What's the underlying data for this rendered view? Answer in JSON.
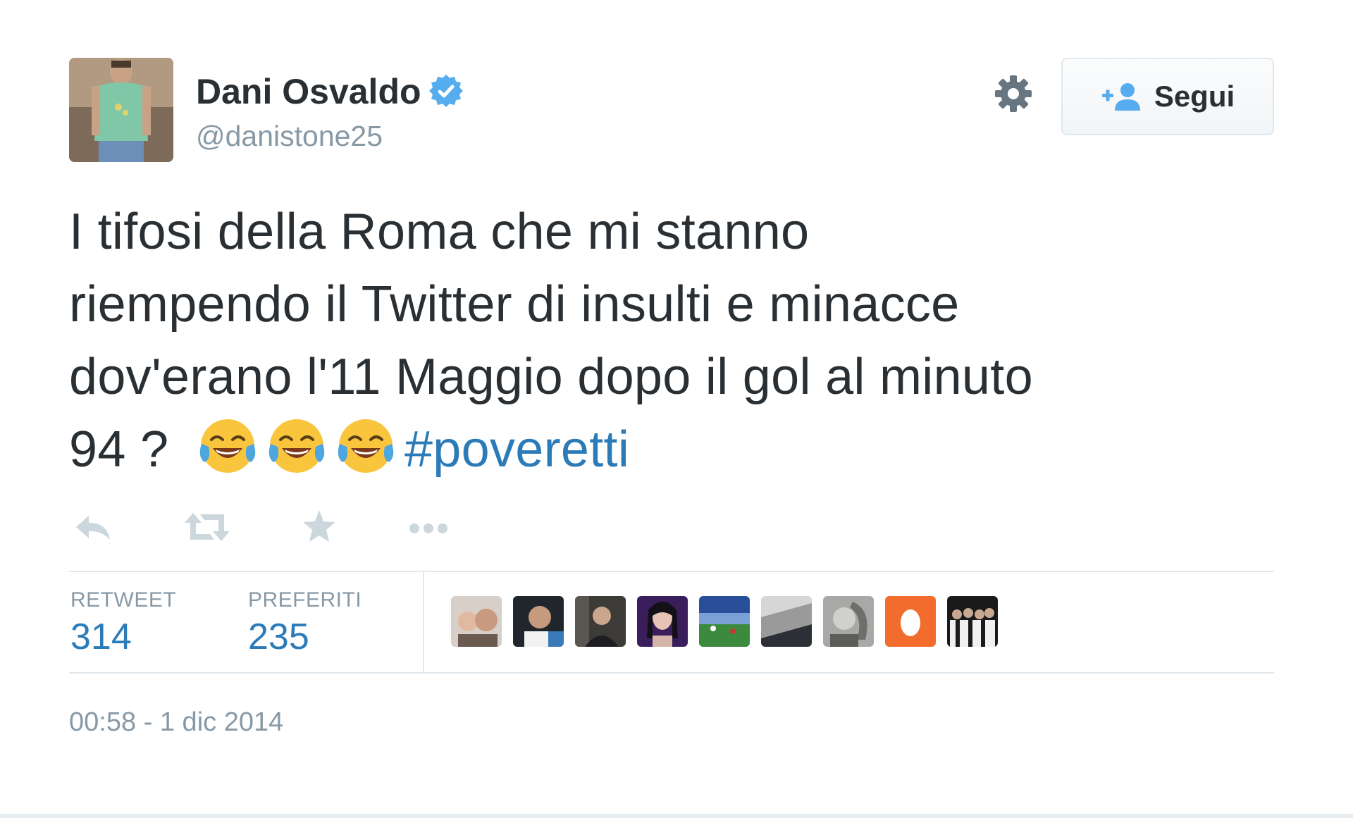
{
  "author": {
    "display_name": "Dani Osvaldo",
    "handle": "@danistone25",
    "verified": true,
    "avatar_icon": "profile-photo"
  },
  "header": {
    "settings_icon": "gear-icon",
    "follow_label": "Segui",
    "follow_icon": "add-user-icon"
  },
  "tweet": {
    "lines": [
      "I tifosi della Roma che mi stanno",
      "riempendo il Twitter di insulti e minacce",
      "dov'erano l'11 Maggio dopo il gol al minuto",
      "94 ?"
    ],
    "emoji_icon": "face-with-tears-of-joy-icon",
    "emoji_count": 3,
    "hashtag": "#poveretti"
  },
  "actions": [
    {
      "name": "reply-icon"
    },
    {
      "name": "retweet-icon"
    },
    {
      "name": "favorite-star-icon"
    },
    {
      "name": "more-dots-icon"
    }
  ],
  "stats": {
    "retweet_label": "RETWEET",
    "retweet_count": "314",
    "favorites_label": "PREFERITI",
    "favorites_count": "235"
  },
  "favoriters": [
    {
      "name": "favoriter-avatar-1"
    },
    {
      "name": "favoriter-avatar-2"
    },
    {
      "name": "favoriter-avatar-3"
    },
    {
      "name": "favoriter-avatar-4"
    },
    {
      "name": "favoriter-avatar-5"
    },
    {
      "name": "favoriter-avatar-6"
    },
    {
      "name": "favoriter-avatar-7"
    },
    {
      "name": "favoriter-avatar-8"
    },
    {
      "name": "favoriter-avatar-9"
    }
  ],
  "timestamp": "00:58 - 1 dic 2014",
  "colors": {
    "text": "#292f33",
    "muted": "#8899a6",
    "link": "#2b7bb9",
    "verified": "#55acee",
    "action_icon": "#ccd6dd",
    "border": "#e1e8ed"
  }
}
